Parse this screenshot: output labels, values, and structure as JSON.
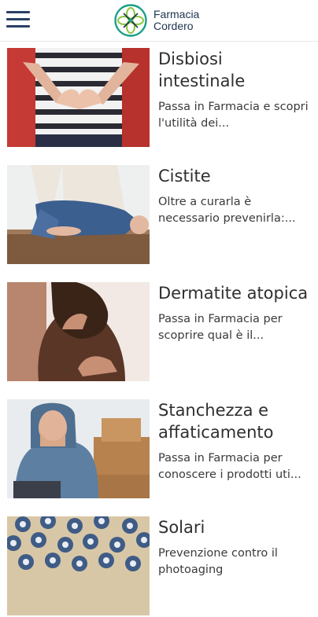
{
  "header": {
    "brand_line1": "Farmacia",
    "brand_line2": "Cordero",
    "logo_color": "#1b9f88",
    "menu_color": "#2a3f66"
  },
  "articles": [
    {
      "title": "Disbiosi intestinale",
      "description": "Passa in Farmacia e scopri l'utilità dei..."
    },
    {
      "title": "Cistite",
      "description": "Oltre a curarla è necessario prevenirla:..."
    },
    {
      "title": "Dermatite atopica",
      "description": "Passa in Farmacia per scoprire qual è il..."
    },
    {
      "title": "Stanchezza e affaticamento",
      "description": "Passa in Farmacia per conoscere i prodotti uti..."
    },
    {
      "title": "Solari",
      "description": "Prevenzione contro il photoaging"
    }
  ]
}
